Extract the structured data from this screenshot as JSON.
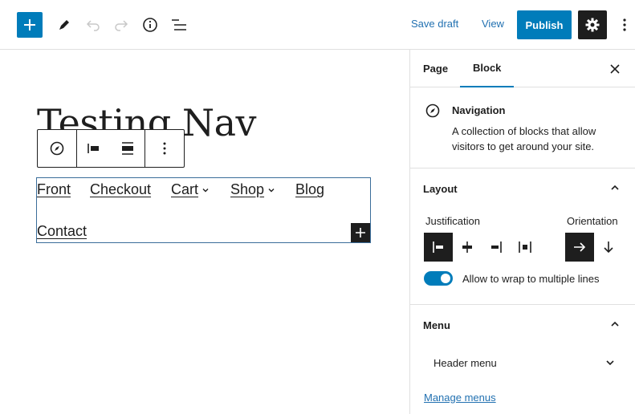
{
  "toolbar": {
    "save_draft": "Save draft",
    "view": "View",
    "publish": "Publish"
  },
  "canvas": {
    "title": "Testing Nav",
    "nav_items": [
      {
        "label": "Front",
        "has_submenu": false
      },
      {
        "label": "Checkout",
        "has_submenu": false
      },
      {
        "label": "Cart",
        "has_submenu": true
      },
      {
        "label": "Shop",
        "has_submenu": true
      },
      {
        "label": "Blog",
        "has_submenu": false
      },
      {
        "label": "Contact",
        "has_submenu": false
      }
    ]
  },
  "sidebar": {
    "tabs": [
      {
        "label": "Page",
        "active": false
      },
      {
        "label": "Block",
        "active": true
      }
    ],
    "block": {
      "name": "Navigation",
      "description": "A collection of blocks that allow visitors to get around your site."
    },
    "layout": {
      "title": "Layout",
      "justification_label": "Justification",
      "orientation_label": "Orientation",
      "justification_selected": "left",
      "orientation_selected": "horizontal",
      "wrap_label": "Allow to wrap to multiple lines",
      "wrap_enabled": true
    },
    "menu": {
      "title": "Menu",
      "selected": "Header menu",
      "manage_link": "Manage menus"
    }
  },
  "colors": {
    "accent": "#007cba",
    "link": "#2271b1",
    "dark": "#1e1e1e",
    "selection_border": "#3a6d9a"
  }
}
